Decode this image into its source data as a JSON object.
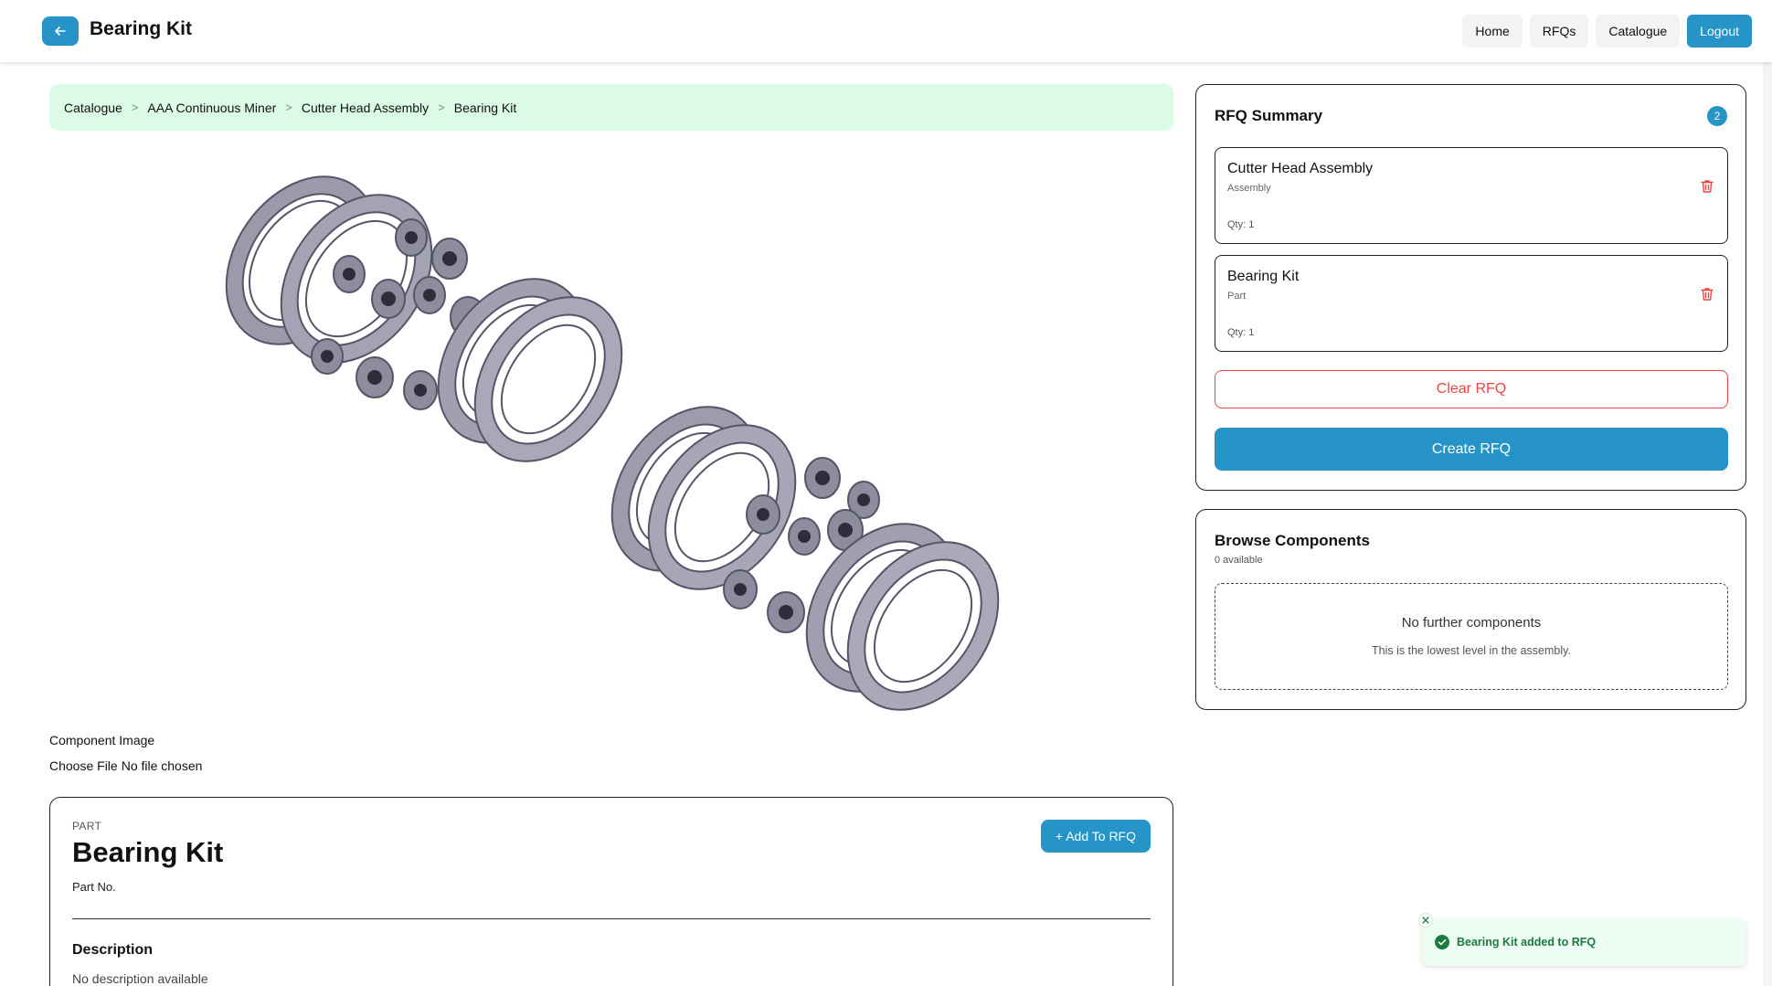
{
  "header": {
    "title": "Bearing Kit",
    "nav": [
      "Home",
      "RFQs",
      "Catalogue",
      "Logout"
    ]
  },
  "breadcrumb": [
    "Catalogue",
    "AAA Continuous Miner",
    "Cutter Head Assembly",
    "Bearing Kit"
  ],
  "breadcrumb_sep": ">",
  "upload": {
    "label": "Component Image",
    "button": "Choose File",
    "status": "No file chosen"
  },
  "details": {
    "kind": "PART",
    "title": "Bearing Kit",
    "part_no_label": "Part No.",
    "add_button": "+ Add To RFQ",
    "description_heading": "Description",
    "description_text": "No description available"
  },
  "rfq": {
    "title": "RFQ Summary",
    "count": "2",
    "items": [
      {
        "name": "Cutter Head Assembly",
        "type": "Assembly",
        "qty": "Qty: 1"
      },
      {
        "name": "Bearing Kit",
        "type": "Part",
        "qty": "Qty: 1"
      }
    ],
    "clear_button": "Clear RFQ",
    "create_button": "Create RFQ"
  },
  "browse": {
    "title": "Browse Components",
    "count": "0 available",
    "empty_title": "No further components",
    "empty_sub": "This is the lowest level in the assembly."
  },
  "toast": {
    "message": "Bearing Kit added to RFQ"
  },
  "colors": {
    "accent": "#2694c6",
    "danger": "#ef4444",
    "success": "#1b7a3c",
    "breadcrumb_bg": "#dcfbe6"
  },
  "icons": {
    "back": "arrow-left-icon",
    "trash": "trash-icon",
    "check": "check-circle-icon",
    "close": "close-icon"
  }
}
